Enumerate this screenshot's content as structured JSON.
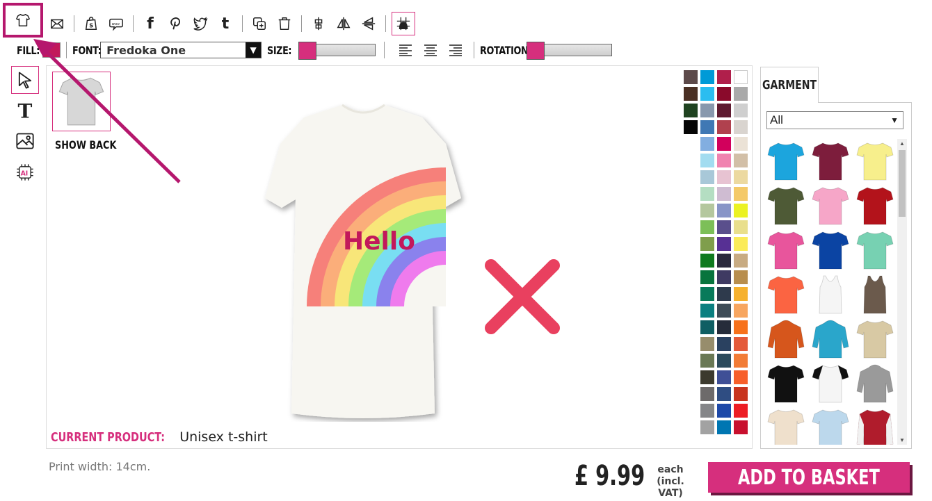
{
  "toolbar": {
    "fill_label": "FILL:",
    "fill_color": "#c2185b",
    "font_label": "FONT:",
    "font_value": "Fredoka One",
    "size_label": "SIZE:",
    "rotation_label": "ROTATION:",
    "accent": "#d62f7d",
    "social": {
      "facebook": "f",
      "tumblr": "t"
    }
  },
  "canvas": {
    "show_back_label": "SHOW BACK",
    "current_product_label": "CURRENT PRODUCT:",
    "current_product_value": "Unisex t-shirt",
    "design_text": "Hello"
  },
  "palette": {
    "colors": [
      "#5d4a4a",
      "#009ad7",
      "#b01f4b",
      "#ffffff",
      "#4a3024",
      "#2bbdf0",
      "#8a0a2b",
      "#a9a9a9",
      "#1f4320",
      "#8898ad",
      "#5e1a30",
      "#cfcfcf",
      "#050505",
      "#3f78b4",
      "#b0414e",
      "#d9d4cf",
      null,
      "#82aee0",
      "#d2005c",
      "#ebe2d6",
      null,
      "#a2dcf0",
      "#f083b0",
      "#d2bfa7",
      null,
      "#a8c8d8",
      "#e7c3d2",
      "#ecd9a0",
      null,
      "#b4dec2",
      "#cfbcd2",
      "#f4c968",
      null,
      "#b4c79e",
      "#8895c7",
      "#ebf223",
      null,
      "#7cbf58",
      "#5a4f8c",
      "#e9df8c",
      null,
      "#7f9e4c",
      "#573094",
      "#fbeb59",
      null,
      "#0f7a1e",
      "#2b2a3d",
      "#c8ab82",
      null,
      "#08743d",
      "#3f3a62",
      "#b88e4e",
      null,
      "#087a5a",
      "#2e3a4c",
      "#f6b12e",
      null,
      "#0a7f80",
      "#3e4c57",
      "#f7a660",
      null,
      "#0f5e63",
      "#262c3a",
      "#f7711b",
      null,
      "#978d6c",
      "#2a4160",
      "#e45a3a",
      null,
      "#6a7955",
      "#2c4b5c",
      "#f27c36",
      null,
      "#3c3a2e",
      "#3f4f96",
      "#f75f2a",
      null,
      "#6d6a6a",
      "#2f4d82",
      "#c8341e",
      null,
      "#858689",
      "#1e49a8",
      "#ed1d24",
      null,
      "#a2a2a2",
      "#0076b2",
      "#c8102e"
    ]
  },
  "garment": {
    "tab_label": "GARMENT",
    "filter_value": "All",
    "items": [
      {
        "name": "tshirt-sky-blue",
        "color": "#1ca5dd",
        "type": "tee"
      },
      {
        "name": "tshirt-maroon",
        "color": "#7d1d3c",
        "type": "tee"
      },
      {
        "name": "tshirt-lemon",
        "color": "#f7ef8c",
        "type": "tee"
      },
      {
        "name": "tshirt-olive",
        "color": "#4e5a36",
        "type": "tee"
      },
      {
        "name": "tshirt-pink",
        "color": "#f6a6c8",
        "type": "tee"
      },
      {
        "name": "tshirt-red",
        "color": "#b3131b",
        "type": "tee"
      },
      {
        "name": "tshirt-fuchsia",
        "color": "#e8559c",
        "type": "tee"
      },
      {
        "name": "tshirt-royal",
        "color": "#0b44a3",
        "type": "tee"
      },
      {
        "name": "tshirt-mint",
        "color": "#77d1b2",
        "type": "tee"
      },
      {
        "name": "tshirt-coral",
        "color": "#fb6442",
        "type": "tee"
      },
      {
        "name": "vest-white",
        "color": "#f5f5f5",
        "type": "vest"
      },
      {
        "name": "vest-brown",
        "color": "#6b5a4c",
        "type": "vest"
      },
      {
        "name": "hoodie-orange",
        "color": "#d6561c",
        "type": "hoodie"
      },
      {
        "name": "hoodie-turquoise",
        "color": "#2aa6cb",
        "type": "hoodie"
      },
      {
        "name": "tshirt-tiedye",
        "color": "#d8c9a4",
        "type": "tee"
      },
      {
        "name": "tshirt-black",
        "color": "#111111",
        "type": "tee"
      },
      {
        "name": "raglan-black-white",
        "color": "#f5f5f5",
        "type": "raglan"
      },
      {
        "name": "hoodie-grey",
        "color": "#9a9a9a",
        "type": "hoodie"
      },
      {
        "name": "tshirt-natural",
        "color": "#efe0cc",
        "type": "tee"
      },
      {
        "name": "tshirt-light-blue",
        "color": "#bcd8ec",
        "type": "tee"
      },
      {
        "name": "jacket-varsity",
        "color": "#b01c2c",
        "type": "jacket"
      }
    ]
  },
  "bottom": {
    "print_width": "Print width: 14cm.",
    "price": "£ 9.99",
    "each_line1": "each",
    "each_line2": "(incl. VAT)",
    "add_to_basket": "ADD TO BASKET"
  }
}
